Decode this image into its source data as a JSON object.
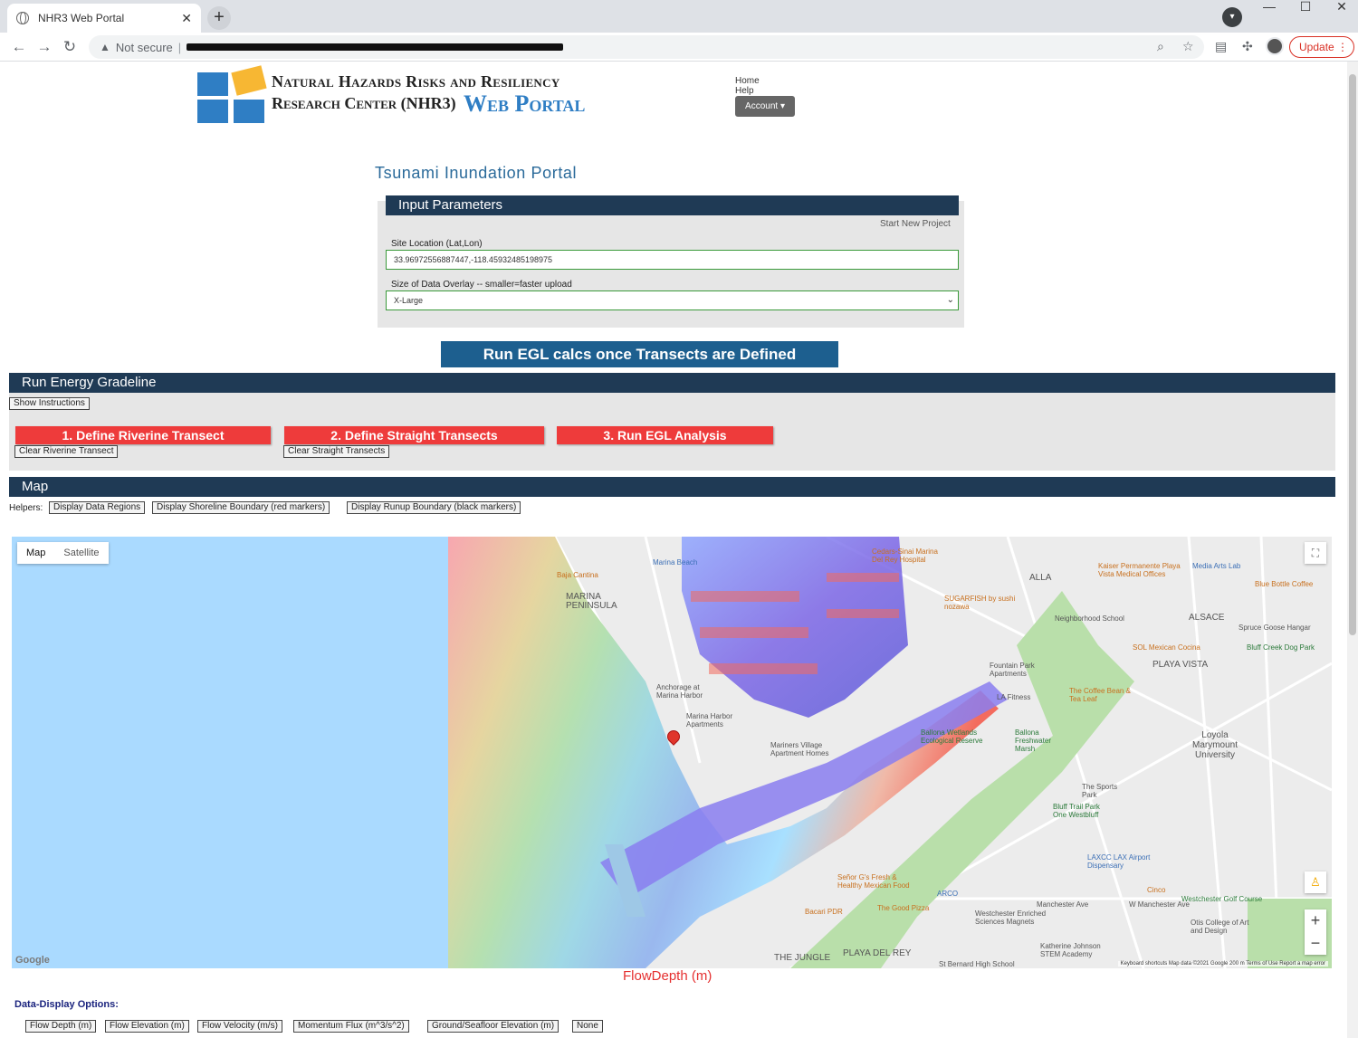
{
  "browser": {
    "tab_title": "NHR3 Web Portal",
    "tab_close": "✕",
    "new_tab": "+",
    "security": "Not secure",
    "update_label": "Update",
    "window_controls": [
      "—",
      "☐",
      "✕"
    ]
  },
  "header": {
    "logo_line1": "Natural Hazards Risks and Resiliency",
    "logo_line2": "Research Center (NHR3)",
    "logo_line3": "Web Portal",
    "nav": [
      "Home",
      "Help"
    ],
    "account_label": "Account ▾"
  },
  "portal_title": "Tsunami Inundation Portal",
  "input_parameters": {
    "heading": "Input Parameters",
    "start_new_project": "Start New Project",
    "site_location_label": "Site Location (Lat,Lon)",
    "site_location_value": "33.96972556887447,-118.45932485198975",
    "overlay_size_label": "Size of Data Overlay -- smaller=faster upload",
    "overlay_size_value": "X-Large"
  },
  "run_egl_button": "Run EGL calcs once Transects are Defined",
  "energy_gradeline": {
    "heading": "Run Energy Gradeline",
    "show_instructions": "Show Instructions",
    "step1": "1. Define Riverine Transect",
    "step2": "2. Define Straight Transects",
    "step3": "3. Run EGL Analysis",
    "clear_riverine": "Clear Riverine Transect",
    "clear_straight": "Clear Straight Transects"
  },
  "map_section": {
    "heading": "Map",
    "helpers_label": "Helpers:",
    "helpers": [
      "Display Data Regions",
      "Display Shoreline Boundary (red markers)",
      "Display Runup Boundary (black markers)"
    ],
    "map_type": [
      "Map",
      "Satellite"
    ],
    "attribution": "Keyboard shortcuts   Map data ©2021 Google   200 m   Terms of Use   Report a map error",
    "google": "Google",
    "places": [
      {
        "name": "Marina Beach",
        "style": "blue"
      },
      {
        "name": "Baja Cantina",
        "style": "orange"
      },
      {
        "name": "MARINA PENINSULA",
        "style": "big"
      },
      {
        "name": "Cedars-Sinai Marina Del Rey Hospital",
        "style": "orange"
      },
      {
        "name": "Kaiser Permanente Playa Vista Medical Offices",
        "style": "orange"
      },
      {
        "name": "Media Arts Lab",
        "style": "blue"
      },
      {
        "name": "ALLA",
        "style": "big"
      },
      {
        "name": "Blue Bottle Coffee",
        "style": "orange"
      },
      {
        "name": "SUGARFISH by sushi nozawa",
        "style": "orange"
      },
      {
        "name": "Neighborhood School",
        "style": "plain"
      },
      {
        "name": "ALSACE",
        "style": "big"
      },
      {
        "name": "Spruce Goose Hangar",
        "style": "plain"
      },
      {
        "name": "Bluff Creek Dog Park",
        "style": "green"
      },
      {
        "name": "SOL Mexican Cocina",
        "style": "orange"
      },
      {
        "name": "PLAYA VISTA",
        "style": "big"
      },
      {
        "name": "Fountain Park Apartments",
        "style": "plain"
      },
      {
        "name": "LA Fitness",
        "style": "plain"
      },
      {
        "name": "The Coffee Bean & Tea Leaf",
        "style": "orange"
      },
      {
        "name": "Anchorage at Marina Harbor",
        "style": "plain"
      },
      {
        "name": "Marina Harbor Apartments",
        "style": "plain"
      },
      {
        "name": "Ballona Wetlands Ecological Reserve",
        "style": "green"
      },
      {
        "name": "Ballona Freshwater Marsh",
        "style": "green"
      },
      {
        "name": "Loyola Marymount University",
        "style": "big"
      },
      {
        "name": "Mariners Village Apartment Homes",
        "style": "plain"
      },
      {
        "name": "The Sports Park",
        "style": "plain"
      },
      {
        "name": "Bluff Trail Park One Westbluff",
        "style": "green"
      },
      {
        "name": "LAXCC LAX Airport Dispensary",
        "style": "blue"
      },
      {
        "name": "Señor G's Fresh & Healthy Mexican Food",
        "style": "orange"
      },
      {
        "name": "ARCO",
        "style": "blue"
      },
      {
        "name": "The Good Pizza",
        "style": "orange"
      },
      {
        "name": "Cinco",
        "style": "orange"
      },
      {
        "name": "Westchester Golf Course",
        "style": "green"
      },
      {
        "name": "Manchester Ave",
        "style": "plain"
      },
      {
        "name": "W Manchester Ave",
        "style": "plain"
      },
      {
        "name": "Westchester Enriched Sciences Magnets",
        "style": "plain"
      },
      {
        "name": "Otis College of Art and Design",
        "style": "plain"
      },
      {
        "name": "Bacari PDR",
        "style": "orange"
      },
      {
        "name": "Katherine Johnson STEM Academy",
        "style": "plain"
      },
      {
        "name": "PLAYA DEL REY",
        "style": "big"
      },
      {
        "name": "St Bernard High School",
        "style": "plain"
      },
      {
        "name": "THE JUNGLE",
        "style": "big"
      }
    ]
  },
  "flow_caption": "FlowDepth (m)",
  "data_display": {
    "label": "Data-Display Options:",
    "options": [
      "Flow Depth (m)",
      "Flow Elevation (m)",
      "Flow Velocity (m/s)",
      "Momentum Flux (m^3/s^2)",
      "Ground/Seafloor Elevation (m)",
      "None"
    ]
  },
  "colors": {
    "header_bar": "#1f3a55",
    "run_button": "#1d5f8f",
    "red_button": "#ee3b3b",
    "water": "#aadaff",
    "title_blue": "#2a6a9a"
  }
}
